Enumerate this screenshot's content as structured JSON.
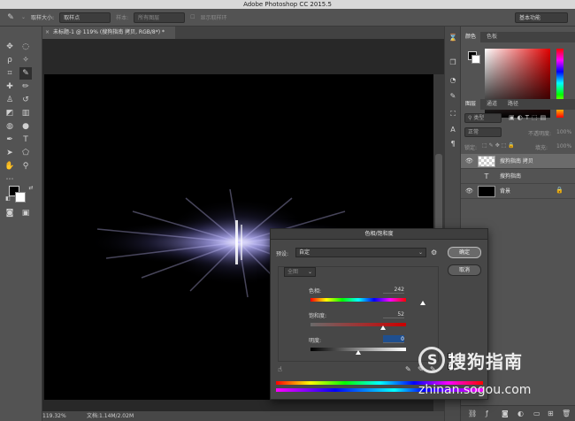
{
  "window": {
    "title": "Adobe Photoshop CC 2015.5"
  },
  "options_bar": {
    "sample_size_label": "取样大小:",
    "sample_size_value": "取样点",
    "sample_label": "样本:",
    "sample_value": "所有图层",
    "show_ring_label": "显示取样环",
    "workspace": "基本功能"
  },
  "document": {
    "tab_label": "未标题-1 @ 119% (搜狗指南 拷贝, RGB/8*) *",
    "close_glyph": "×"
  },
  "status": {
    "zoom": "119.32%",
    "doc_info": "文档:1.14M/2.02M"
  },
  "color_panel": {
    "tabs": [
      "颜色",
      "色板"
    ]
  },
  "layers_panel": {
    "tabs": [
      "图层",
      "通道",
      "路径"
    ],
    "kind_filter": "类型",
    "blend_mode": "正常",
    "opacity_label": "不透明度:",
    "opacity_value": "100%",
    "lock_label": "锁定:",
    "fill_label": "填充:",
    "fill_value": "100%",
    "layers": [
      {
        "name": "搜狗指南 拷贝",
        "selected": true,
        "type": "raster"
      },
      {
        "name": "搜狗指南",
        "selected": false,
        "type": "text"
      },
      {
        "name": "背景",
        "selected": false,
        "type": "background"
      }
    ]
  },
  "dialog": {
    "title": "色相/饱和度",
    "preset_label": "预设:",
    "preset_value": "自定",
    "channel_value": "全图",
    "hue_label": "色相:",
    "hue_value": "242",
    "saturation_label": "饱和度:",
    "saturation_value": "52",
    "lightness_label": "明度:",
    "lightness_value": "0",
    "ok_label": "确定",
    "cancel_label": "取消",
    "hue_range": [
      -180,
      180
    ],
    "saturation_range": [
      -100,
      100
    ],
    "lightness_range": [
      -100,
      100
    ]
  },
  "watermark": {
    "brand_cn": "搜狗指南",
    "url": "zhinan.sogou.com"
  }
}
